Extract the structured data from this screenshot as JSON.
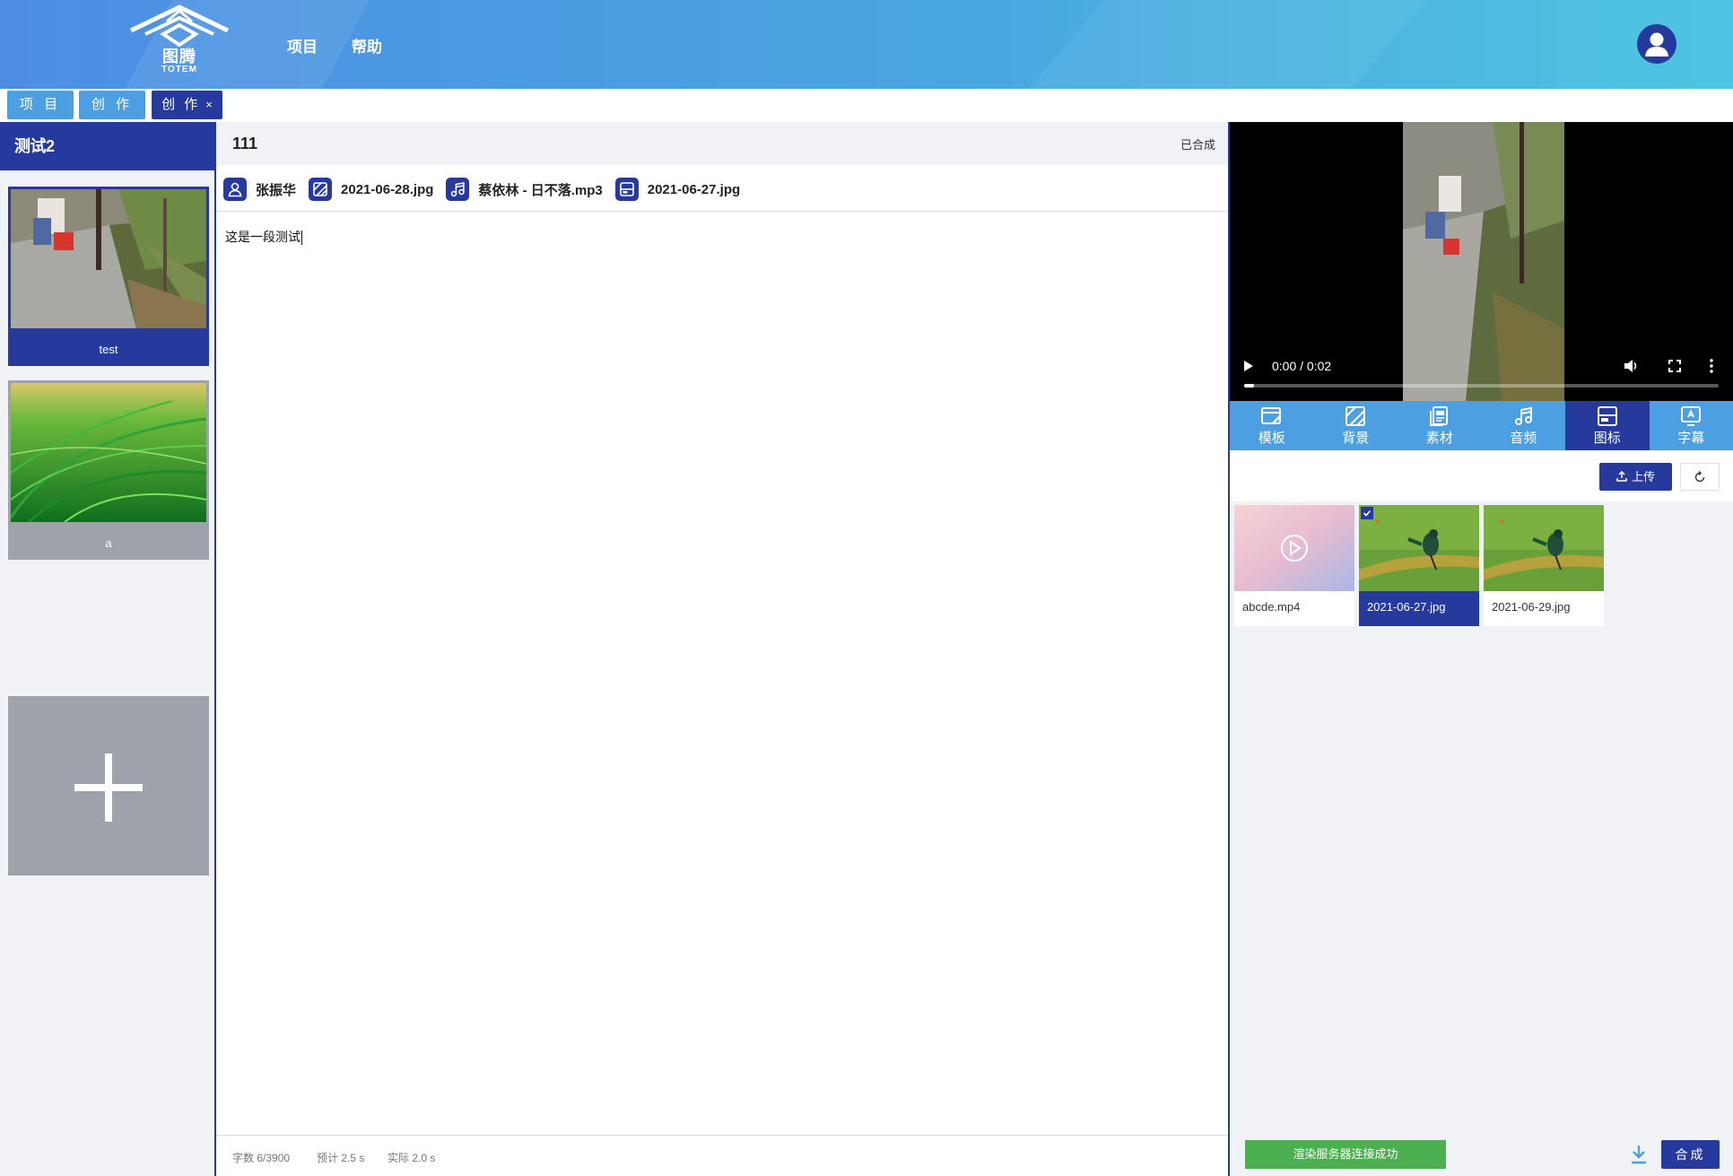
{
  "header": {
    "logo_cn": "图腾",
    "logo_en": "TOTEM",
    "nav": [
      "项目",
      "帮助"
    ]
  },
  "tabs": [
    {
      "label": "项 目"
    },
    {
      "label": "创 作"
    },
    {
      "label": "创 作",
      "close": "×"
    }
  ],
  "sidebar": {
    "title": "测试2",
    "cards": [
      {
        "caption": "test",
        "active": true
      },
      {
        "caption": "a",
        "active": false
      }
    ],
    "add_icon": "plus-icon"
  },
  "editor": {
    "name": "111",
    "status": "已合成",
    "chips": [
      {
        "icon": "user-icon",
        "label": "张振华"
      },
      {
        "icon": "background-icon",
        "label": "2021-06-28.jpg"
      },
      {
        "icon": "music-icon",
        "label": "蔡依林 - 日不落.mp3"
      },
      {
        "icon": "image-icon",
        "label": "2021-06-27.jpg"
      }
    ],
    "text": "这是一段测试",
    "footer": {
      "word_count": "字数 6/3900",
      "estimated": "预计 2.5 s",
      "actual": "实际 2.0 s"
    }
  },
  "player": {
    "time": "0:00 / 0:02",
    "progress": 0.02
  },
  "panel_tabs": [
    {
      "label": "模板",
      "icon": "template-icon",
      "active": false
    },
    {
      "label": "背景",
      "icon": "background-icon",
      "active": false
    },
    {
      "label": "素材",
      "icon": "material-icon",
      "active": false
    },
    {
      "label": "音频",
      "icon": "music-icon",
      "active": false
    },
    {
      "label": "图标",
      "icon": "image-icon",
      "active": true
    },
    {
      "label": "字幕",
      "icon": "subtitle-icon",
      "active": false
    }
  ],
  "assets": {
    "upload_label": "上传",
    "items": [
      {
        "name": "abcde.mp4",
        "selected": false
      },
      {
        "name": "2021-06-27.jpg",
        "selected": true
      },
      {
        "name": "2021-06-29.jpg",
        "selected": false
      }
    ]
  },
  "footer": {
    "server_status": "渲染服务器连接成功",
    "compose_label": "合成"
  },
  "colors": {
    "primary_dark": "#253a9c",
    "primary_light": "#4c9fe0",
    "success": "#4caf50"
  }
}
